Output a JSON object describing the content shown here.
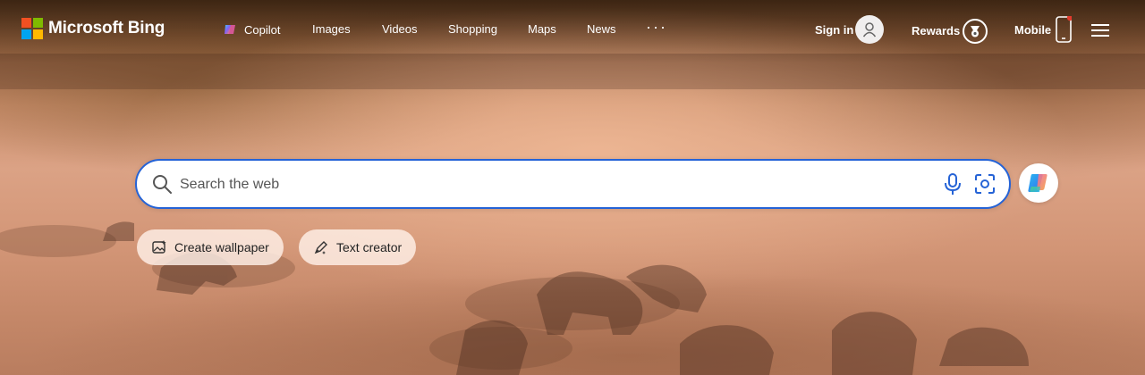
{
  "brand": {
    "name": "Microsoft Bing"
  },
  "nav": {
    "items": [
      {
        "label": "Copilot"
      },
      {
        "label": "Images"
      },
      {
        "label": "Videos"
      },
      {
        "label": "Shopping"
      },
      {
        "label": "Maps"
      },
      {
        "label": "News"
      }
    ],
    "more": "···"
  },
  "header_right": {
    "sign_in": "Sign in",
    "rewards": "Rewards",
    "mobile": "Mobile"
  },
  "search": {
    "placeholder": "Search the web",
    "value": ""
  },
  "chips": [
    {
      "label": "Create wallpaper",
      "icon": "image-sparkle-icon"
    },
    {
      "label": "Text creator",
      "icon": "pen-sparkle-icon"
    }
  ],
  "colors": {
    "search_border": "#2563d6",
    "ms_red": "#f25022",
    "ms_green": "#7fba00",
    "ms_blue": "#00a4ef",
    "ms_yellow": "#ffb900",
    "notification_dot": "#e23b2e"
  }
}
